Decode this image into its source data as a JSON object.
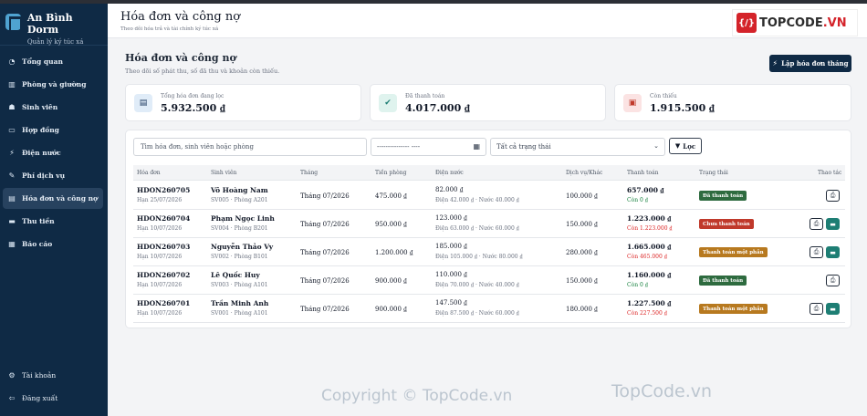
{
  "sidebar": {
    "brand_name": "An Bình Dorm",
    "brand_sub": "Quản lý ký túc xá",
    "items": [
      {
        "label": "Tổng quan",
        "icon": "dashboard-icon"
      },
      {
        "label": "Phòng và giường",
        "icon": "door-icon"
      },
      {
        "label": "Sinh viên",
        "icon": "users-icon"
      },
      {
        "label": "Hợp đồng",
        "icon": "contract-icon"
      },
      {
        "label": "Điện nước",
        "icon": "bolt-icon"
      },
      {
        "label": "Phí dịch vụ",
        "icon": "service-icon"
      },
      {
        "label": "Hóa đơn và công nợ",
        "icon": "invoice-icon",
        "active": true
      },
      {
        "label": "Thu tiền",
        "icon": "money-icon"
      },
      {
        "label": "Báo cáo",
        "icon": "chart-icon"
      }
    ],
    "account": "Tài khoản",
    "logout": "Đăng xuất"
  },
  "header": {
    "title": "Hóa đơn và công nợ",
    "subtitle": "Theo dõi hóa trả và tài chính ký túc xá",
    "logo_text_left": "TOPCODE",
    "logo_text_right": ".VN"
  },
  "main": {
    "title": "Hóa đơn và công nợ",
    "subtitle": "Theo dõi số phát thu, số đã thu và khoản còn thiếu.",
    "create_button": "Lập hóa đơn tháng"
  },
  "stats": [
    {
      "label": "Tổng hóa đơn đang lọc",
      "value": "5.932.500 ₫",
      "icon": "document-icon",
      "bg": "#e0ecf8",
      "fg": "#1e3a5f"
    },
    {
      "label": "Đã thanh toán",
      "value": "4.017.000 ₫",
      "icon": "check-icon",
      "bg": "#dff3ee",
      "fg": "#1e7e74"
    },
    {
      "label": "Còn thiếu",
      "value": "1.915.500 ₫",
      "icon": "wallet-icon",
      "bg": "#fbe3e3",
      "fg": "#c0392b"
    }
  ],
  "filters": {
    "search_placeholder": "Tìm hóa đơn, sinh viên hoặc phòng",
    "date_value": "--------------- ----",
    "status_value": "Tất cả trạng thái",
    "filter_button": "Lọc"
  },
  "table": {
    "headers": [
      "Hóa đơn",
      "Sinh viên",
      "Tháng",
      "Tiền phòng",
      "Điện nước",
      "Dịch vụ/Khác",
      "Thanh toán",
      "Trạng thái",
      "Thao tác"
    ],
    "rows": [
      {
        "code": "HDON260705",
        "due": "Hạn 25/07/2026",
        "name": "Võ Hoàng Nam",
        "room": "SV005 · Phòng A201",
        "month": "Tháng 07/2026",
        "rent": "475.000 ₫",
        "util": "82.000 ₫",
        "util_detail": "Điện 42.000 ₫ · Nước 40.000 ₫",
        "service": "100.000 ₫",
        "total": "657.000 ₫",
        "remain": "Còn 0 ₫",
        "remain_state": "ok",
        "status": "Đã thanh toán",
        "status_type": "paid",
        "pay": false
      },
      {
        "code": "HDON260704",
        "due": "Hạn 10/07/2026",
        "name": "Phạm Ngọc Linh",
        "room": "SV004 · Phòng B201",
        "month": "Tháng 07/2026",
        "rent": "950.000 ₫",
        "util": "123.000 ₫",
        "util_detail": "Điện 63.000 ₫ · Nước 60.000 ₫",
        "service": "150.000 ₫",
        "total": "1.223.000 ₫",
        "remain": "Còn 1.223.000 ₫",
        "remain_state": "due",
        "status": "Chưa thanh toán",
        "status_type": "unpaid",
        "pay": true
      },
      {
        "code": "HDON260703",
        "due": "Hạn 10/07/2026",
        "name": "Nguyễn Thảo Vy",
        "room": "SV002 · Phòng B101",
        "month": "Tháng 07/2026",
        "rent": "1.200.000 ₫",
        "util": "185.000 ₫",
        "util_detail": "Điện 105.000 ₫ · Nước 80.000 ₫",
        "service": "280.000 ₫",
        "total": "1.665.000 ₫",
        "remain": "Còn 465.000 ₫",
        "remain_state": "due",
        "status": "Thanh toán một phần",
        "status_type": "partial",
        "pay": true
      },
      {
        "code": "HDON260702",
        "due": "Hạn 10/07/2026",
        "name": "Lê Quốc Huy",
        "room": "SV003 · Phòng A101",
        "month": "Tháng 07/2026",
        "rent": "900.000 ₫",
        "util": "110.000 ₫",
        "util_detail": "Điện 70.000 ₫ · Nước 40.000 ₫",
        "service": "150.000 ₫",
        "total": "1.160.000 ₫",
        "remain": "Còn 0 ₫",
        "remain_state": "ok",
        "status": "Đã thanh toán",
        "status_type": "paid",
        "pay": false
      },
      {
        "code": "HDON260701",
        "due": "Hạn 10/07/2026",
        "name": "Trần Minh Anh",
        "room": "SV001 · Phòng A101",
        "month": "Tháng 07/2026",
        "rent": "900.000 ₫",
        "util": "147.500 ₫",
        "util_detail": "Điện 87.500 ₫ · Nước 60.000 ₫",
        "service": "180.000 ₫",
        "total": "1.227.500 ₫",
        "remain": "Còn 227.500 ₫",
        "remain_state": "due",
        "status": "Thanh toán một phần",
        "status_type": "partial",
        "pay": true
      }
    ]
  },
  "watermarks": [
    "Copyright © TopCode.vn",
    "TopCode.vn"
  ]
}
